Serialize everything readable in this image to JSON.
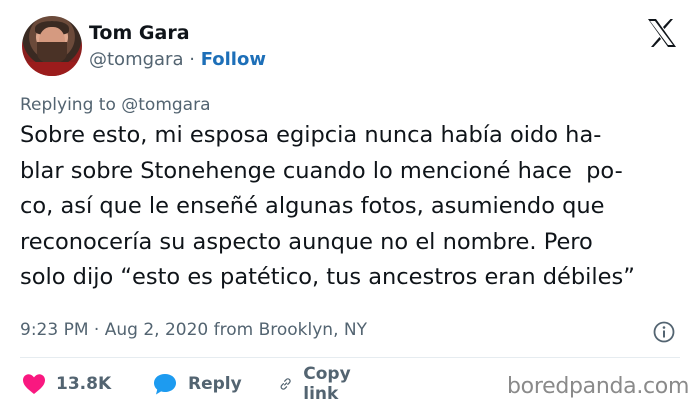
{
  "author": {
    "name": "Tom Gara",
    "handle": "@tomgara",
    "separator": "·",
    "follow_label": "Follow"
  },
  "reply_context": {
    "prefix": "Replying to",
    "mention": "@tomgara"
  },
  "body_lines": [
    "Sobre esto, mi esposa egipcia nunca había oido ha-",
    "blar sobre Stonehenge cuando lo mencioné hace  po-",
    "co, así que le enseñé algunas fotos, asumiendo que",
    "reconocería su aspecto aunque no el nombre. Pero",
    "solo dijo “esto es patético, tus ancestros eran débiles”"
  ],
  "meta": {
    "time": "9:23 PM",
    "separator": "·",
    "date": "Aug 2, 2020",
    "location": "from Brooklyn, NY"
  },
  "actions": {
    "like_count": "13.8K",
    "reply_label": "Reply",
    "copy_link_label": "Copy link"
  },
  "watermark": "boredpanda.com",
  "colors": {
    "like": "#f91880",
    "reply": "#1d9bf0",
    "follow": "#1d6fb8",
    "muted": "#536471"
  },
  "icons": [
    "avatar",
    "x-logo-icon",
    "info-icon",
    "heart-icon",
    "reply-bubble-icon",
    "link-icon"
  ]
}
